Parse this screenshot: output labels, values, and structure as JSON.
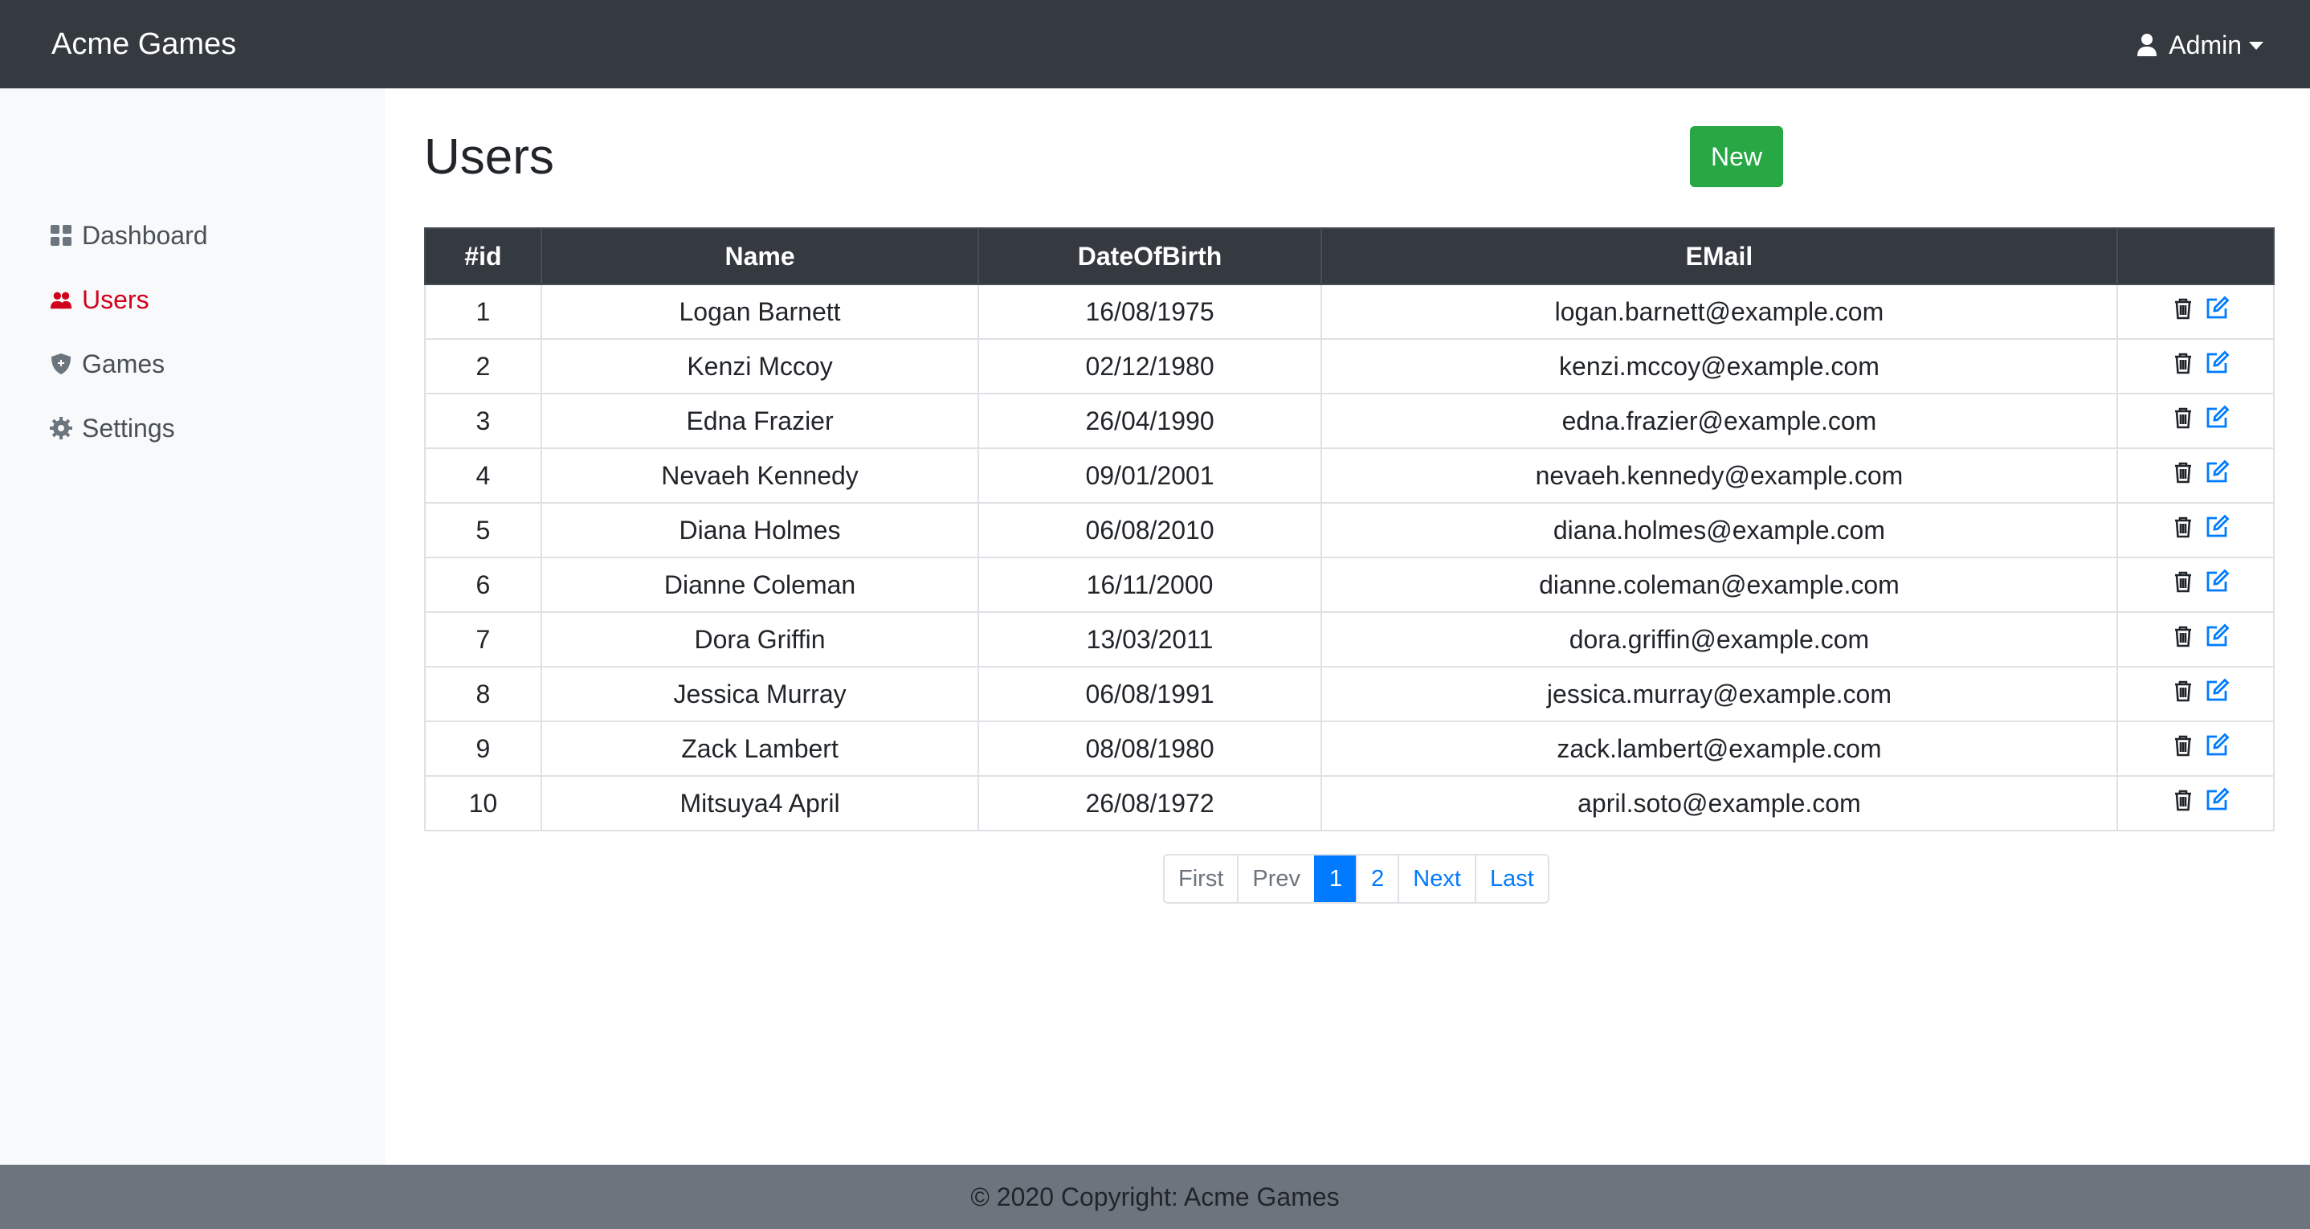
{
  "app": {
    "brand": "Acme Games",
    "user_menu_label": "Admin"
  },
  "sidebar": {
    "items": [
      {
        "label": "Dashboard",
        "icon": "dashboard-icon",
        "active": false
      },
      {
        "label": "Users",
        "icon": "users-icon",
        "active": true
      },
      {
        "label": "Games",
        "icon": "shield-icon",
        "active": false
      },
      {
        "label": "Settings",
        "icon": "gear-icon",
        "active": false
      }
    ]
  },
  "main": {
    "title": "Users",
    "new_button_label": "New"
  },
  "table": {
    "columns": [
      "#id",
      "Name",
      "DateOfBirth",
      "EMail",
      ""
    ],
    "rows": [
      {
        "id": "1",
        "name": "Logan Barnett",
        "dob": "16/08/1975",
        "email": "logan.barnett@example.com"
      },
      {
        "id": "2",
        "name": "Kenzi Mccoy",
        "dob": "02/12/1980",
        "email": "kenzi.mccoy@example.com"
      },
      {
        "id": "3",
        "name": "Edna Frazier",
        "dob": "26/04/1990",
        "email": "edna.frazier@example.com"
      },
      {
        "id": "4",
        "name": "Nevaeh Kennedy",
        "dob": "09/01/2001",
        "email": "nevaeh.kennedy@example.com"
      },
      {
        "id": "5",
        "name": "Diana Holmes",
        "dob": "06/08/2010",
        "email": "diana.holmes@example.com"
      },
      {
        "id": "6",
        "name": "Dianne Coleman",
        "dob": "16/11/2000",
        "email": "dianne.coleman@example.com"
      },
      {
        "id": "7",
        "name": "Dora Griffin",
        "dob": "13/03/2011",
        "email": "dora.griffin@example.com"
      },
      {
        "id": "8",
        "name": "Jessica Murray",
        "dob": "06/08/1991",
        "email": "jessica.murray@example.com"
      },
      {
        "id": "9",
        "name": "Zack Lambert",
        "dob": "08/08/1980",
        "email": "zack.lambert@example.com"
      },
      {
        "id": "10",
        "name": "Mitsuya4 April",
        "dob": "26/08/1972",
        "email": "april.soto@example.com"
      }
    ],
    "row_actions": {
      "delete_icon": "trash-icon",
      "edit_icon": "edit-icon"
    }
  },
  "pagination": {
    "items": [
      {
        "label": "First",
        "state": "disabled"
      },
      {
        "label": "Prev",
        "state": "disabled"
      },
      {
        "label": "1",
        "state": "current"
      },
      {
        "label": "2",
        "state": "link"
      },
      {
        "label": "Next",
        "state": "link"
      },
      {
        "label": "Last",
        "state": "link"
      }
    ]
  },
  "footer": {
    "text": "© 2020 Copyright: Acme Games"
  },
  "colors": {
    "navbar": "#343a40",
    "sidebar": "#f8f9fa",
    "active_nav": "#d0021b",
    "new_button": "#28a745",
    "link": "#007bff",
    "footer": "#6c757d"
  }
}
